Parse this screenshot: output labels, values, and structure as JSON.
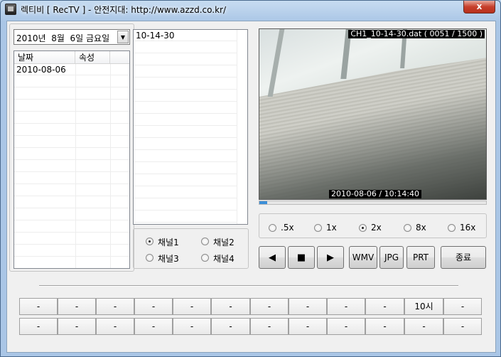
{
  "window": {
    "title": "렉티비 [ RecTV ] - 안전지대: http://www.azzd.co.kr/",
    "close_glyph": "x"
  },
  "date_selector": {
    "value": "2010년  8월  6일 금요일",
    "arrow_glyph": "▼"
  },
  "date_list": {
    "columns": [
      "날짜",
      "속성"
    ],
    "rows": [
      {
        "date": "2010-08-06",
        "attr": ""
      }
    ]
  },
  "file_list": {
    "items": [
      "10-14-30"
    ]
  },
  "channels": {
    "options": [
      "채널1",
      "채널2",
      "채널3",
      "채널4"
    ],
    "selected": "채널1"
  },
  "video": {
    "file_info": "CH1_10-14-30.dat ( 0051 / 1500 )",
    "timestamp": "2010-08-06 / 10:14:40",
    "progress_fraction": 0.034
  },
  "speed": {
    "options": [
      ".5x",
      "1x",
      "2x",
      "8x",
      "16x"
    ],
    "selected": "2x"
  },
  "controls": {
    "prev_glyph": "◀",
    "stop_glyph": "■",
    "play_glyph": "▶",
    "wmv_label": "WMV",
    "jpg_label": "JPG",
    "prt_label": "PRT",
    "exit_label": "종료"
  },
  "hour_buttons": {
    "row1": [
      "-",
      "-",
      "-",
      "-",
      "-",
      "-",
      "-",
      "-",
      "-",
      "-",
      "10시",
      "-"
    ],
    "row2": [
      "-",
      "-",
      "-",
      "-",
      "-",
      "-",
      "-",
      "-",
      "-",
      "-",
      "-",
      "-"
    ]
  }
}
